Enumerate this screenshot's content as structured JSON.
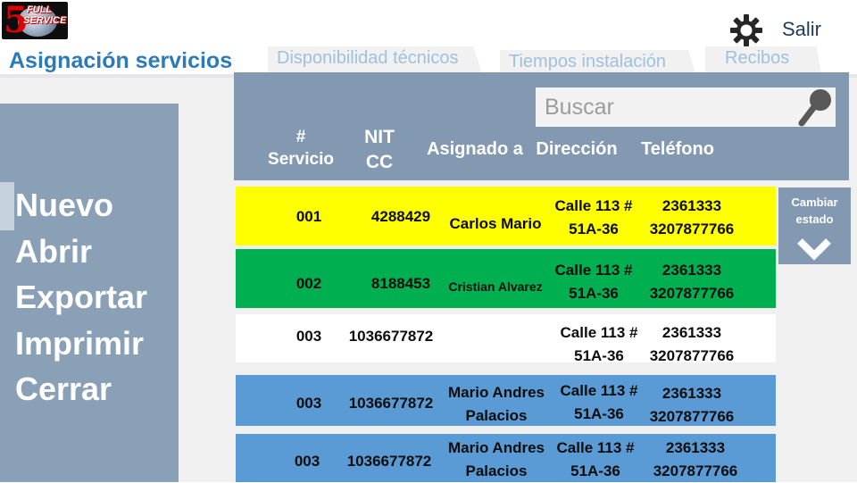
{
  "brand": {
    "logo_line1": "FULL",
    "logo_line2": "SERVICE",
    "logo_number": "5"
  },
  "top_bar": {
    "settings_icon": "gear-icon",
    "salir_label": "Salir"
  },
  "tabs": [
    {
      "label": "Asignación servicios",
      "active": true
    },
    {
      "label": "Disponibilidad técnicos",
      "active": false
    },
    {
      "label": "Tiempos instalación",
      "active": false
    },
    {
      "label": "Recibos",
      "active": false
    }
  ],
  "menu": {
    "items": [
      "Nuevo",
      "Abrir",
      "Exportar",
      "Imprimir",
      "Cerrar"
    ]
  },
  "search": {
    "placeholder": "Buscar",
    "icon": "search-icon"
  },
  "table": {
    "headers": {
      "servicio_line1": "#",
      "servicio_line2": "Servicio",
      "nit_line1": "NIT",
      "nit_line2": "CC",
      "asignado": "Asignado a",
      "direccion": "Dirección",
      "telefono": "Teléfono"
    },
    "rows": [
      {
        "servicio": "001",
        "nit": "4288429",
        "asignado_line1": "Carlos Mario",
        "asignado_line2": "",
        "dir_line1": "Calle 113 #",
        "dir_line2": "51A-36",
        "tel_line1": "2361333",
        "tel_line2": "3207877766",
        "color": "#ffff00"
      },
      {
        "servicio": "002",
        "nit": "8188453",
        "asignado_line1": "Cristian Alvarez",
        "asignado_line2": "",
        "dir_line1": "Calle 113 #",
        "dir_line2": "51A-36",
        "tel_line1": "2361333",
        "tel_line2": "3207877766",
        "color": "#00b050"
      },
      {
        "servicio": "003",
        "nit": "1036677872",
        "asignado_line1": "",
        "asignado_line2": "",
        "dir_line1": "Calle 113 #",
        "dir_line2": "51A-36",
        "tel_line1": "2361333",
        "tel_line2": "3207877766",
        "color": "#ffffff"
      },
      {
        "servicio": "003",
        "nit": "1036677872",
        "asignado_line1": "Mario Andres",
        "asignado_line2": "Palacios",
        "dir_line1": "Calle 113 #",
        "dir_line2": "51A-36",
        "tel_line1": "2361333",
        "tel_line2": "3207877766",
        "color": "#5b9bd5"
      },
      {
        "servicio": "003",
        "nit": "1036677872",
        "asignado_line1": "Mario Andres",
        "asignado_line2": "Palacios",
        "dir_line1": "Calle 113 #",
        "dir_line2": "51A-36",
        "tel_line1": "2361333",
        "tel_line2": "3207877766",
        "color": "#5b9bd5"
      }
    ]
  },
  "side_actions": {
    "cambiar_line1": "Cambiar",
    "cambiar_line2": "estado",
    "chevron_icon": "chevron-down-icon"
  }
}
